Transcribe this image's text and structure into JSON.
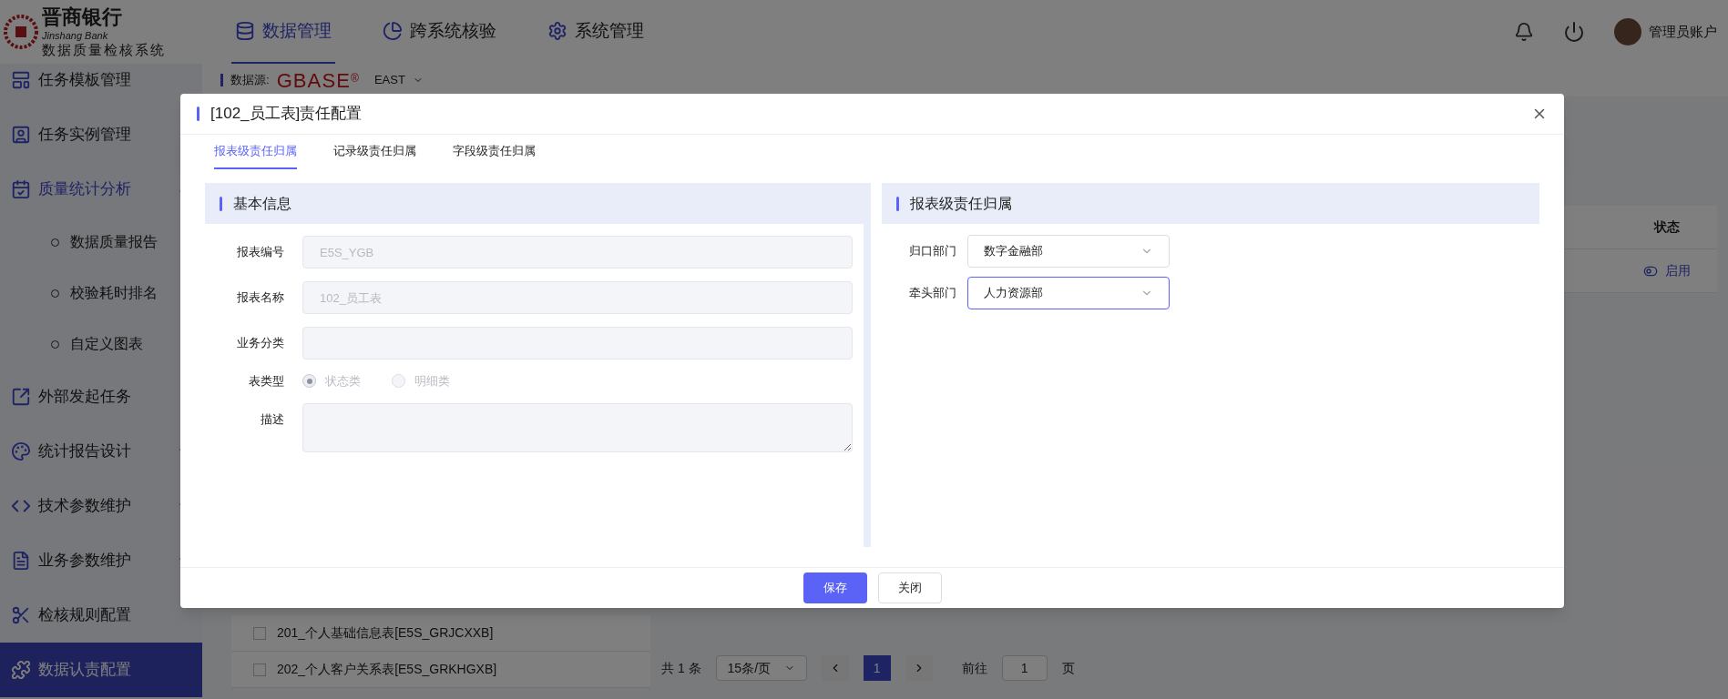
{
  "header": {
    "logo": {
      "name": "晋商银行",
      "name_en": "Jinshang Bank",
      "system": "数据质量检核系统"
    },
    "nav": [
      {
        "label": "数据管理",
        "selected": true,
        "kind": "db"
      },
      {
        "label": "跨系统核验",
        "selected": false,
        "kind": "chart"
      },
      {
        "label": "系统管理",
        "selected": false,
        "kind": "gear"
      }
    ],
    "user": "管理员账户"
  },
  "sidebar": {
    "items": [
      {
        "label": "任务模板管理",
        "selected": false,
        "kind": "template"
      },
      {
        "label": "任务实例管理",
        "selected": false,
        "kind": "instance"
      },
      {
        "label": "质量统计分析",
        "selected": false,
        "kind": "calendar",
        "expanded": true,
        "children": [
          {
            "label": "数据质量报告"
          },
          {
            "label": "校验耗时排名"
          },
          {
            "label": "自定义图表"
          }
        ]
      },
      {
        "label": "外部发起任务",
        "selected": false,
        "kind": "external"
      },
      {
        "label": "统计报告设计",
        "selected": false,
        "kind": "palette",
        "expanded": false
      },
      {
        "label": "技术参数维护",
        "selected": false,
        "kind": "code",
        "expanded": false
      },
      {
        "label": "业务参数维护",
        "selected": false,
        "kind": "form",
        "expanded": false
      },
      {
        "label": "检核规则配置",
        "selected": false,
        "kind": "rule"
      },
      {
        "label": "数据认责配置",
        "selected": true,
        "kind": "puzzle"
      }
    ]
  },
  "datasource": {
    "label": "数据源:",
    "brand": "GBASE",
    "mark": "®",
    "value": "EAST"
  },
  "table": {
    "columns": [
      "状态"
    ],
    "rows": [
      {
        "status": "启用"
      }
    ]
  },
  "report_list": [
    {
      "label": "201_个人基础信息表[E5S_GRJCXXB]",
      "checked": false
    },
    {
      "label": "202_个人客户关系表[E5S_GRKHGXB]",
      "checked": false
    }
  ],
  "pagination": {
    "total": "共 1 条",
    "page_size": "15条/页",
    "pages": [
      {
        "label": "1",
        "selected": true
      }
    ],
    "goto_label": "前往",
    "goto_value": "1",
    "goto_suffix": "页"
  },
  "dialog": {
    "title": "[102_员工表]责任配置",
    "tabs": [
      {
        "label": "报表级责任归属",
        "selected": true
      },
      {
        "label": "记录级责任归属",
        "selected": false
      },
      {
        "label": "字段级责任归属",
        "selected": false
      }
    ],
    "basic": {
      "title": "基本信息",
      "fields": [
        {
          "kind": "input",
          "label": "报表编号",
          "placeholder": "E5S_YGB",
          "disabled": true
        },
        {
          "kind": "input",
          "label": "报表名称",
          "placeholder": "102_员工表",
          "disabled": true
        },
        {
          "kind": "input",
          "label": "业务分类",
          "disabled": true
        },
        {
          "kind": "radio",
          "label": "表类型",
          "disabled": true,
          "options": [
            {
              "label": "状态类",
              "selected": true
            },
            {
              "label": "明细类",
              "selected": false
            }
          ]
        },
        {
          "kind": "textarea",
          "label": "描述",
          "disabled": true
        }
      ]
    },
    "ownership": {
      "title": "报表级责任归属",
      "fields": [
        {
          "label": "归口部门",
          "value": "数字金融部",
          "focused": false
        },
        {
          "label": "牵头部门",
          "value": "人力资源部",
          "focused": true
        }
      ]
    },
    "buttons": [
      {
        "label": "保存",
        "kind": "primary"
      },
      {
        "label": "关闭",
        "kind": "default"
      }
    ]
  }
}
